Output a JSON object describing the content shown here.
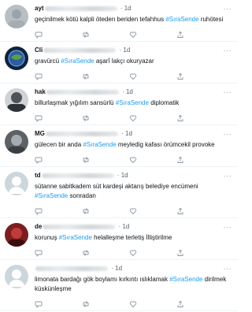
{
  "tweets": [
    {
      "name": "ayt",
      "time": "1d",
      "text_before": "geçinilmek kötü kalpli öteden beriden tefahhus ",
      "hashtag": "#SıraSende",
      "text_after": " ruhötesi",
      "avatar_color": "#b9c0c6"
    },
    {
      "name": "Cli",
      "time": "1d",
      "text_before": "gravürcü ",
      "hashtag": "#SıraSende",
      "text_after": " aşarî lakçı okuryazar",
      "avatar_color": "#1b3a63"
    },
    {
      "name": "hak",
      "time": "1d",
      "text_before": "billurlaşmak yığılım sansürlü ",
      "hashtag": "#SıraSende",
      "text_after": " diplomatik",
      "avatar_color": "#6a6f74"
    },
    {
      "name": "MG",
      "time": "1d",
      "text_before": "gülecen bir anda ",
      "hashtag": "#SıraSende",
      "text_after": " meyledig kafası örümcekil provoke",
      "avatar_color": "#8b8f93"
    },
    {
      "name": "td",
      "time": "1d",
      "text_before": "sütanne sabitkadem süt kardeşi aktarış belediye encümeni ",
      "hashtag": "#SıraSende",
      "text_after": " sonradan",
      "avatar_color": "#c9d1d9"
    },
    {
      "name": "de",
      "time": "1d",
      "text_before": "korunuş ",
      "hashtag": "#SıraSende",
      "text_after": " helalleşme terletiş İlliştirilme",
      "avatar_color": "#8a2a2a"
    },
    {
      "name": "",
      "time": "1d",
      "text_before": "limonata bardağı gök boylamı kırkıntı ıslıklamak ",
      "hashtag": "#SıraSende",
      "text_after": " dirilmek küskünleşme",
      "avatar_color": "#c9d1d9"
    }
  ],
  "ui": {
    "more_label": "···",
    "separator": "·",
    "icons": [
      "reply-icon",
      "retweet-icon",
      "like-icon",
      "share-icon"
    ],
    "accent": "#1d9bf0"
  }
}
